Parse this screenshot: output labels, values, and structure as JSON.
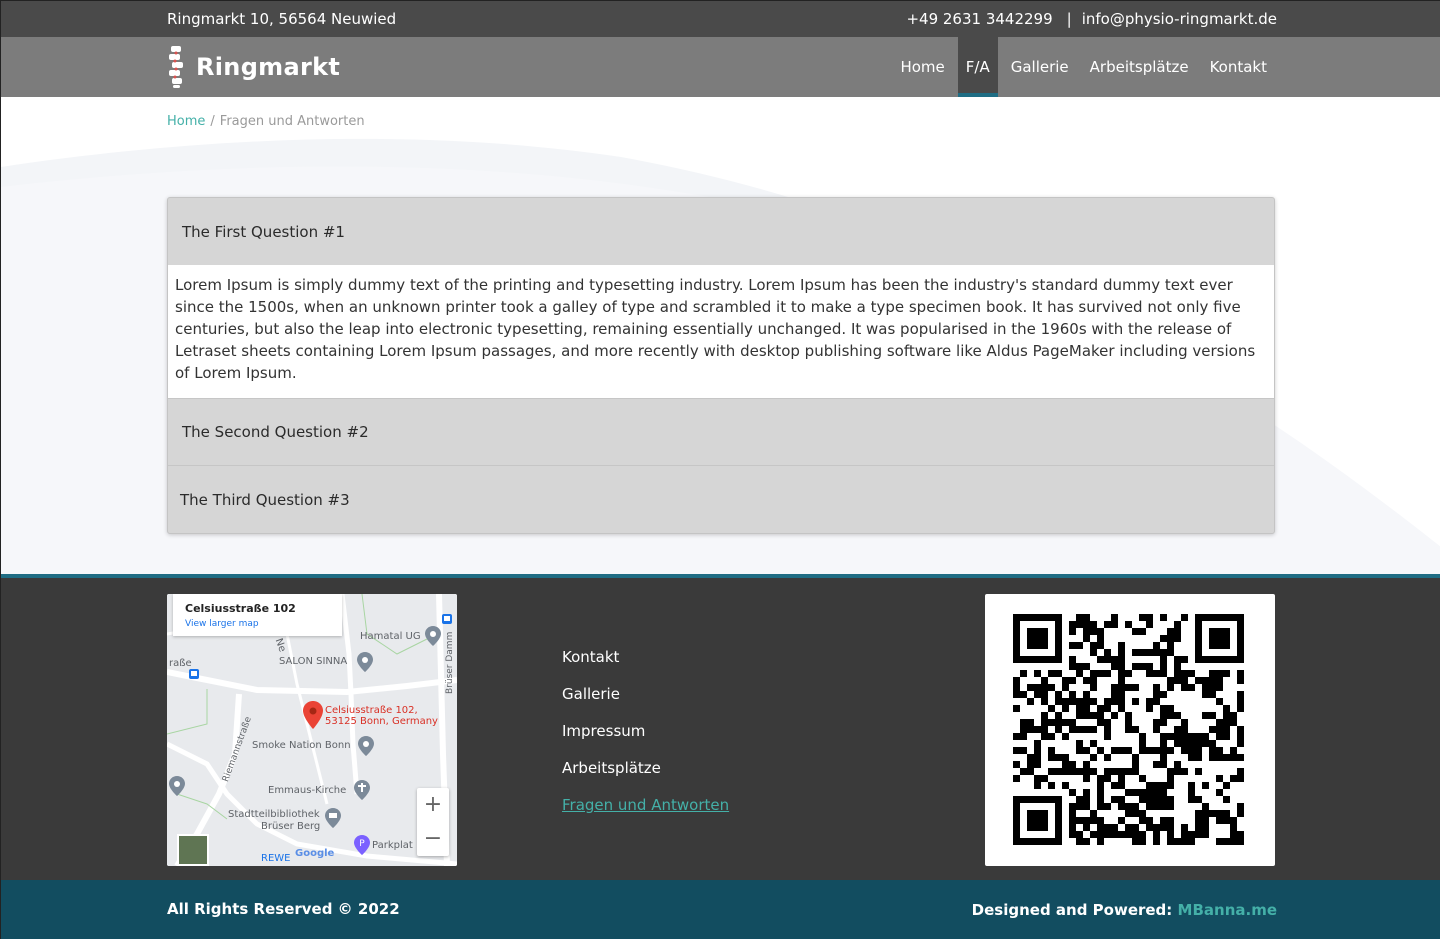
{
  "topbar": {
    "address": "Ringmarkt 10, 56564 Neuwied",
    "phone": "+49 2631 3442299",
    "separator": "|",
    "email": "info@physio-ringmarkt.de"
  },
  "brand": {
    "name": "Ringmarkt"
  },
  "nav": {
    "items": [
      {
        "label": "Home"
      },
      {
        "label": "F/A"
      },
      {
        "label": "Gallerie"
      },
      {
        "label": "Arbeitsplätze"
      },
      {
        "label": "Kontakt"
      }
    ],
    "active": "F/A"
  },
  "breadcrumb": {
    "home": "Home",
    "separator": "/",
    "current": "Fragen und Antworten"
  },
  "faq": {
    "items": [
      {
        "question": "The First Question #1",
        "expanded": true,
        "answer": "Lorem Ipsum is simply dummy text of the printing and typesetting industry. Lorem Ipsum has been the industry's standard dummy text ever since the 1500s, when an unknown printer took a galley of type and scrambled it to make a type specimen book. It has survived not only five centuries, but also the leap into electronic typesetting, remaining essentially unchanged. It was popularised in the 1960s with the release of Letraset sheets containing Lorem Ipsum passages, and more recently with desktop publishing software like Aldus PageMaker including versions of Lorem Ipsum."
      },
      {
        "question": "The Second Question #2",
        "expanded": false
      },
      {
        "question": "The Third Question #3",
        "expanded": false
      }
    ]
  },
  "map": {
    "card_address": "Celsiusstraße 102",
    "card_link": "View larger map",
    "pin_label_line1": "Celsiusstraße 102,",
    "pin_label_line2": "53125 Bonn, Germany",
    "places": {
      "hamatal": "Hamatal UG",
      "salon": "SALON SINNA",
      "smoke": "Smoke Nation Bonn",
      "kirche": "Emmaus-Kirche",
      "bibliothek1": "Stadtteilbibliothek",
      "bibliothek2": "Brüser Berg",
      "parkplatz": "Parkplat",
      "rewe": "REWE",
      "riemann": "Riemannstraße",
      "bruser": "Brüser Damm",
      "strasse": "raße",
      "ne": "Ne"
    },
    "zoom_in": "+",
    "zoom_out": "−",
    "google": "Google"
  },
  "footer": {
    "links": [
      {
        "label": "Kontakt"
      },
      {
        "label": "Gallerie"
      },
      {
        "label": "Impressum"
      },
      {
        "label": "Arbeitsplätze"
      },
      {
        "label": "Fragen und Antworten"
      }
    ],
    "active_link": "Fragen und Antworten"
  },
  "bottombar": {
    "rights": "All Rights Reserved © 2022",
    "powered_label": "Designed and Powered:",
    "powered_brand": "MBanna.me"
  },
  "colors": {
    "topbar": "#4a4a4a",
    "navbar": "#7c7c7c",
    "accent": "#44b0a8",
    "active_underline": "#1f6d84",
    "footer": "#3a3a3a",
    "bottombar": "#124d60"
  }
}
